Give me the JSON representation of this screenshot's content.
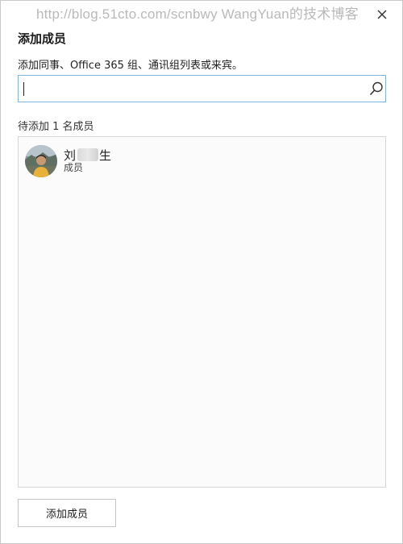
{
  "watermark": "http://blog.51cto.com/scnbwy WangYuan的技术博客",
  "dialog": {
    "title": "添加成员",
    "instructions": "添加同事、Office 365 组、通讯组列表或来宾。",
    "close_icon": "close-icon"
  },
  "search": {
    "value": "",
    "placeholder": "",
    "icon": "search-icon"
  },
  "pending": {
    "label": "待添加 1 名成员",
    "members": [
      {
        "name_start": "刘",
        "name_end": "生",
        "role": "成员"
      }
    ]
  },
  "footer": {
    "add_button_label": "添加成员"
  },
  "colors": {
    "search_border": "#7fb5dd",
    "list_border": "#d6d6d6",
    "button_border": "#c6c6c6"
  }
}
